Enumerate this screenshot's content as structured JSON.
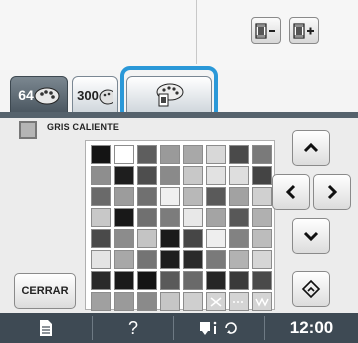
{
  "tabs": [
    {
      "label": "64",
      "active": true
    },
    {
      "label": "300",
      "active": false
    },
    {
      "label": "",
      "active": false
    }
  ],
  "selected_color": {
    "name": "GRIS CALIENTE",
    "hex": "#b5b5b5"
  },
  "buttons": {
    "close_label": "CERRAR"
  },
  "status_bar": {
    "help_label": "?",
    "time": "12:00"
  },
  "accent_color": "#2a98d8",
  "palette": [
    [
      "#141414",
      "#ffffff",
      "#5e5e5e",
      "#9a9a9a",
      "#a8a8a8",
      "#d8d8d8",
      "#4a4a4a",
      "#7a7a7a"
    ],
    [
      "#8e8e8e",
      "#1e1e1e",
      "#4e4e4e",
      "#8a8a8a",
      "#c8c8c8",
      "#e2e2e2",
      "#dedede",
      "#444444"
    ],
    [
      "#6a6a6a",
      "#9c9c9c",
      "#707070",
      "#f0f0f0",
      "#b8b8b8",
      "#5a5a5a",
      "#a2a2a2",
      "#d0d0d0"
    ],
    [
      "#c8c8c8",
      "#181818",
      "#707070",
      "#7c7c7c",
      "#e8e8e8",
      "#a4a4a4",
      "#585858",
      "#b0b0b0"
    ],
    [
      "#4a4a4a",
      "#8c8c8c",
      "#c4c4c4",
      "#1a1a1a",
      "#464646",
      "#eeeeee",
      "#828282",
      "#bcbcbc"
    ],
    [
      "#e4e4e4",
      "#a8a8a8",
      "#747474",
      "#1e1e1e",
      "#2a2a2a",
      "#7a7a7a",
      "#b2b2b2",
      "#d6d6d6"
    ],
    [
      "#2a2a2a",
      "#1a1a1a",
      "#141414",
      "#5a5a5a",
      "#6a6a6a",
      "#262626",
      "#3a3a3a",
      "#4a4a4a"
    ],
    [
      "#a0a0a0",
      "#9a9a9a",
      "#8a8a8a",
      "#c6c6c6",
      "#cfcfcf",
      "special-x",
      "special-dots",
      "special-ww"
    ]
  ]
}
